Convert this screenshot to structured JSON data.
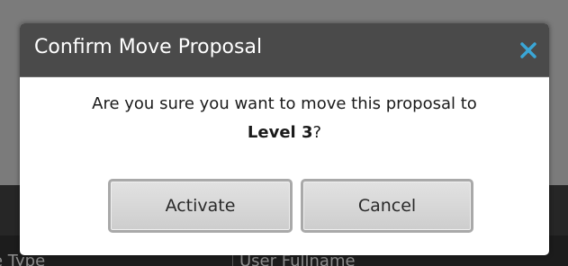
{
  "background": {
    "columns": [
      "e Type",
      "User Fullname"
    ]
  },
  "dialog": {
    "title": "Confirm Move Proposal",
    "close_icon": "close-icon",
    "message_prefix": "Are you sure you want to move this proposal to",
    "level": "Level 3",
    "message_suffix": "?",
    "buttons": {
      "activate": "Activate",
      "cancel": "Cancel"
    }
  },
  "colors": {
    "header_bg": "#4a4a4a",
    "close_icon": "#3aa6d6",
    "button_bg": "#d6d6d6"
  }
}
